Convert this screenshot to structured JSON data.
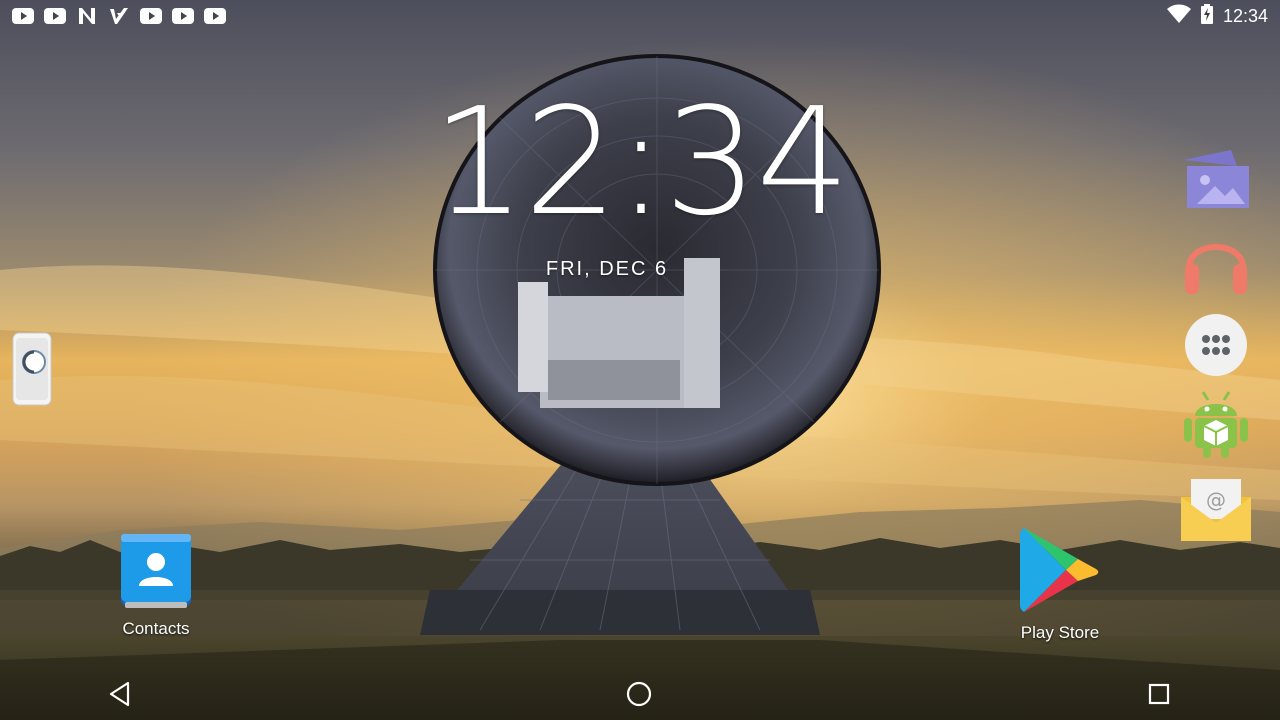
{
  "status_bar": {
    "notifications": [
      "youtube-icon",
      "youtube-icon",
      "n-app-icon",
      "check-app-icon",
      "youtube-icon",
      "youtube-icon",
      "youtube-icon"
    ],
    "time": "12:34",
    "icons": [
      "wifi-icon",
      "battery-charging-icon"
    ]
  },
  "lockscreen": {
    "clock": "12:34",
    "date": "FRI, DEC 6"
  },
  "home": {
    "apps": [
      {
        "label": "Contacts",
        "icon": "contacts-icon"
      },
      {
        "label": "Play Store",
        "icon": "play-store-icon"
      }
    ],
    "dock": [
      "gallery-icon",
      "music-icon",
      "app-drawer-icon",
      "apk-installer-icon",
      "email-icon"
    ]
  },
  "navigation": [
    "back",
    "home",
    "recents"
  ],
  "colors": {
    "gallery": "#8c86d9",
    "music": "#f07a6a",
    "android": "#8bc34a",
    "email": "#f4c13c",
    "contacts": "#1e88e5"
  }
}
